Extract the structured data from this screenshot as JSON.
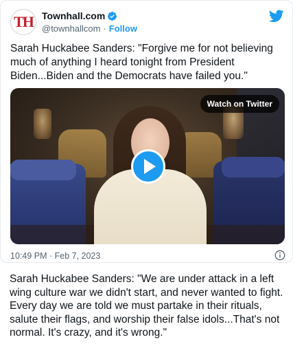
{
  "tweet": {
    "display_name": "Townhall.com",
    "handle": "@townhallcom",
    "separator": "·",
    "follow_label": "Follow",
    "avatar_text": "TH",
    "text": "Sarah Huckabee Sanders: \"Forgive me for not believing much of anything I heard tonight from President Biden...Biden and the Democrats have failed you.\"",
    "media": {
      "watch_label": "Watch on Twitter",
      "play_icon": "play-icon"
    },
    "timestamp": "10:49 PM · Feb 7, 2023"
  },
  "caption": "Sarah Huckabee Sanders: \"We are under attack in a left wing culture war we didn't start, and never wanted to fight. Every day we are told we must partake in their rituals, salute their flags, and worship their false idols...That's not normal. It's crazy, and it's wrong.\"",
  "colors": {
    "accent": "#1d9bf0",
    "logo_red": "#c8202f",
    "muted_text": "#536471"
  },
  "icons": [
    "verified-icon",
    "twitter-bird-icon",
    "info-icon",
    "play-icon"
  ]
}
